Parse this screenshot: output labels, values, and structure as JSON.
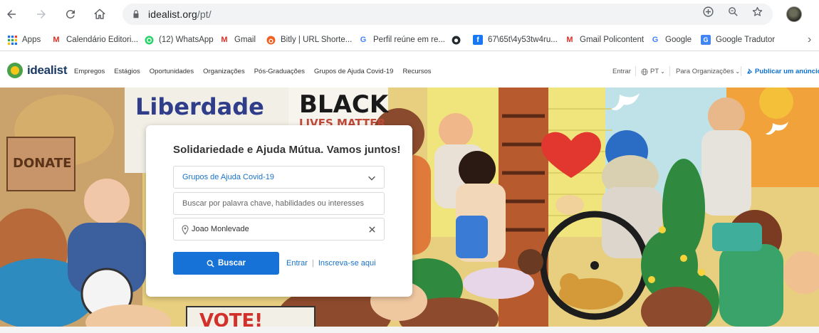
{
  "browser": {
    "url_host": "idealist.org",
    "url_path": "/pt/",
    "bookmarks": [
      {
        "label": "Apps",
        "icon": "apps-grid-icon"
      },
      {
        "label": "Calendário Editori...",
        "icon": "gmail-icon"
      },
      {
        "label": "(12) WhatsApp",
        "icon": "whatsapp-icon"
      },
      {
        "label": "Gmail",
        "icon": "gmail-icon"
      },
      {
        "label": "Bitly | URL Shorte...",
        "icon": "bitly-icon"
      },
      {
        "label": "Perfil reúne em re...",
        "icon": "google-icon"
      },
      {
        "label": "",
        "icon": "github-icon"
      },
      {
        "label": "67\\65t\\4y53tw4ru...",
        "icon": "facebook-icon"
      },
      {
        "label": "Gmail Policontent",
        "icon": "gmail-icon"
      },
      {
        "label": "Google",
        "icon": "google-icon"
      },
      {
        "label": "Google Tradutor",
        "icon": "google-translate-icon"
      }
    ]
  },
  "site": {
    "logo_text": "idealist",
    "nav": [
      "Empregos",
      "Estágios",
      "Oportunidades",
      "Organizações",
      "Pós-Graduações",
      "Grupos de Ajuda Covid-19",
      "Recursos"
    ],
    "login": "Entrar",
    "language": "PT",
    "for_orgs": "Para Organizações",
    "publish": "Publicar um anúncio"
  },
  "hero": {
    "title": "Solidariedade e Ajuda Mútua. Vamos juntos!",
    "category_select": "Grupos de Ajuda Covid-19",
    "keyword_placeholder": "Buscar por palavra chave, habilidades ou interesses",
    "location_value": "Joao Monlevade",
    "search_button": "Buscar",
    "login_link": "Entrar",
    "signup_link": "Inscreva-se aqui",
    "art_signs": [
      "Liberdade",
      "BLACK",
      "LIVES MATTER",
      "DONATE",
      "VOTE!"
    ]
  },
  "colors": {
    "brand_blue": "#1672d6",
    "brand_navy": "#1b3a66",
    "logo_green": "#4aa14a",
    "logo_yellow": "#f5c518"
  }
}
